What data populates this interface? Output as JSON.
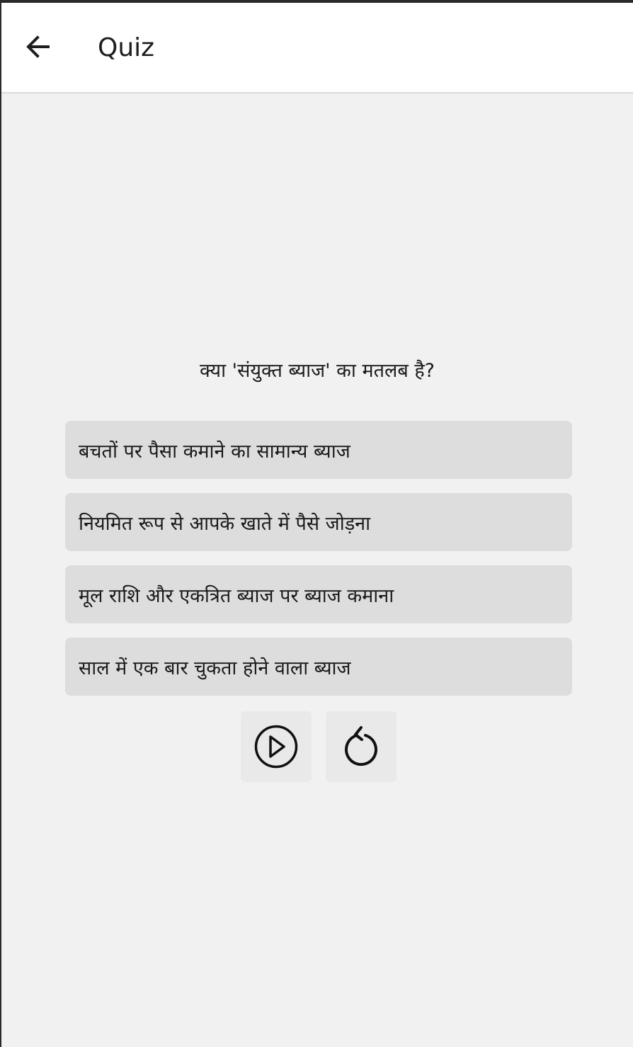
{
  "appbar": {
    "back_icon": "arrow-left-icon",
    "title": "Quiz"
  },
  "quiz": {
    "question": "क्या 'संयुक्त ब्याज' का मतलब है?",
    "options": [
      "बचतों पर पैसा कमाने का सामान्य ब्याज",
      "नियमित रूप से आपके खाते में पैसे जोड़ना",
      "मूल राशि और एकत्रित ब्याज पर ब्याज कमाना",
      "साल में एक बार चुकता होने वाला ब्याज"
    ]
  },
  "controls": {
    "play_icon": "play-circle-icon",
    "restart_icon": "restart-icon"
  },
  "colors": {
    "background": "#f1f1f1",
    "appbar": "#ffffff",
    "option_bg": "#dddddd",
    "control_bg": "#e9e9e9",
    "text": "#1a1a1a"
  }
}
